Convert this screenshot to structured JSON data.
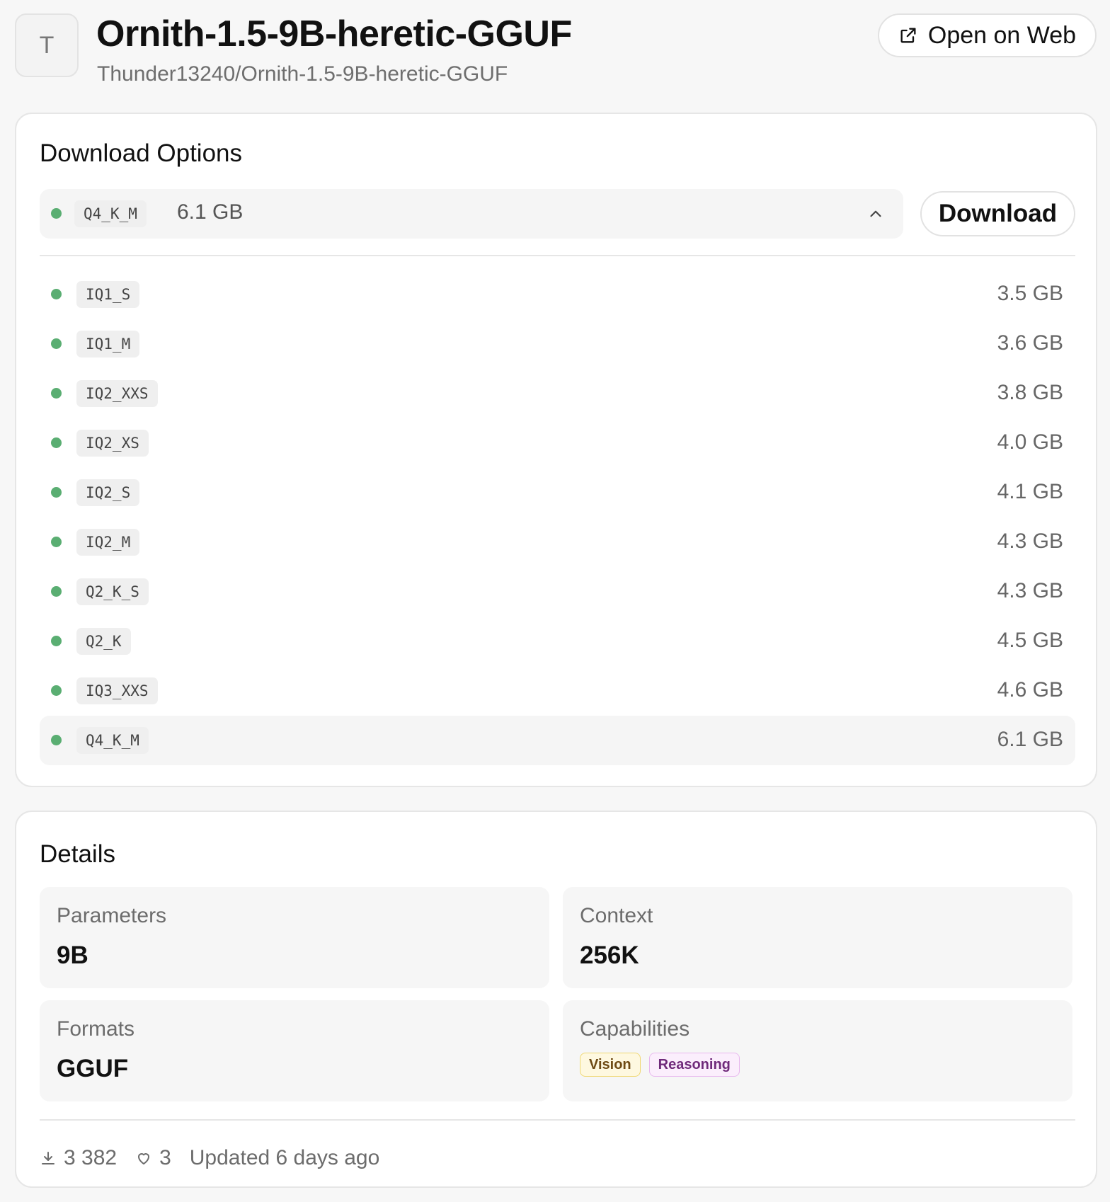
{
  "header": {
    "avatar_letter": "T",
    "title": "Ornith-1.5-9B-heretic-GGUF",
    "repo_path": "Thunder13240/Ornith-1.5-9B-heretic-GGUF",
    "open_web_label": "Open on Web"
  },
  "download_options": {
    "title": "Download Options",
    "selected": {
      "quant": "Q4_K_M",
      "size": "6.1 GB"
    },
    "download_label": "Download",
    "options": [
      {
        "quant": "IQ1_S",
        "size": "3.5 GB"
      },
      {
        "quant": "IQ1_M",
        "size": "3.6 GB"
      },
      {
        "quant": "IQ2_XXS",
        "size": "3.8 GB"
      },
      {
        "quant": "IQ2_XS",
        "size": "4.0 GB"
      },
      {
        "quant": "IQ2_S",
        "size": "4.1 GB"
      },
      {
        "quant": "IQ2_M",
        "size": "4.3 GB"
      },
      {
        "quant": "Q2_K_S",
        "size": "4.3 GB"
      },
      {
        "quant": "Q2_K",
        "size": "4.5 GB"
      },
      {
        "quant": "IQ3_XXS",
        "size": "4.6 GB"
      },
      {
        "quant": "Q4_K_M",
        "size": "6.1 GB"
      }
    ]
  },
  "details": {
    "title": "Details",
    "parameters": {
      "label": "Parameters",
      "value": "9B"
    },
    "context": {
      "label": "Context",
      "value": "256K"
    },
    "formats": {
      "label": "Formats",
      "value": "GGUF"
    },
    "capabilities": {
      "label": "Capabilities",
      "badges": [
        "Vision",
        "Reasoning"
      ]
    }
  },
  "footer": {
    "downloads": "3 382",
    "likes": "3",
    "updated": "Updated 6 days ago"
  },
  "colors": {
    "status_dot": "#5aae72",
    "vision_badge_bg": "#fef8e0",
    "reasoning_badge_bg": "#fbeefc"
  }
}
